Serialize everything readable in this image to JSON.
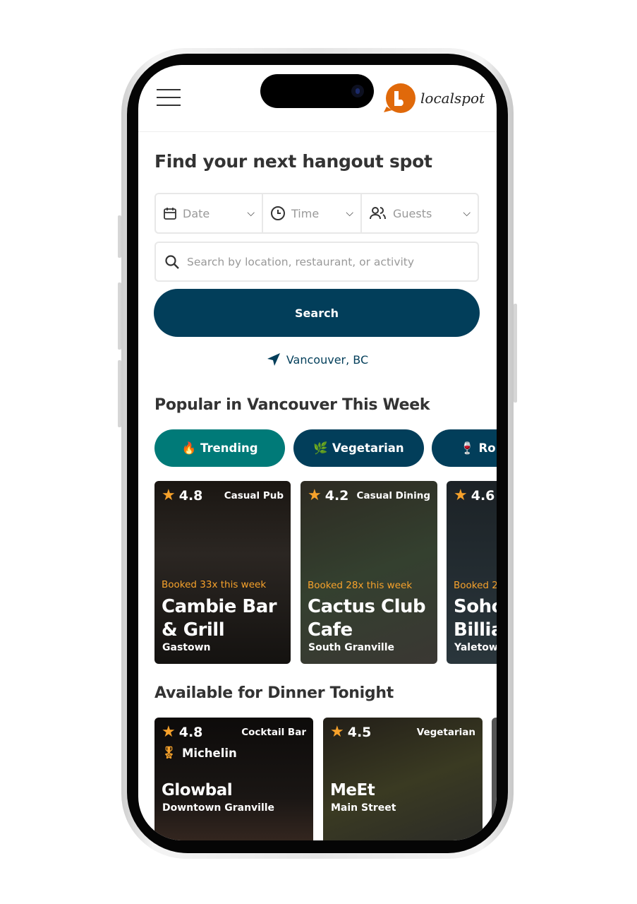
{
  "header": {
    "brand": "localspot",
    "menu_icon": "hamburger-icon"
  },
  "hero": {
    "title": "Find your next hangout spot"
  },
  "filters": [
    {
      "label": "Date",
      "icon": "calendar-icon"
    },
    {
      "label": "Time",
      "icon": "clock-icon"
    },
    {
      "label": "Guests",
      "icon": "users-icon"
    }
  ],
  "search": {
    "placeholder": "Search by location, restaurant, or activity",
    "button": "Search"
  },
  "location": "Vancouver, BC",
  "popular": {
    "title": "Popular in Vancouver This Week",
    "chips": [
      {
        "emoji": "🔥",
        "label": "Trending",
        "color": "#007a78"
      },
      {
        "emoji": "🌿",
        "label": "Vegetarian",
        "color": "#023e5a"
      },
      {
        "emoji": "🍷",
        "label": "Romantic",
        "color": "#023e5a"
      }
    ],
    "cards": [
      {
        "rating": "4.8",
        "category": "Casual Pub",
        "booked": "Booked 33x this week",
        "name": "Cambie Bar & Grill",
        "area": "Gastown"
      },
      {
        "rating": "4.2",
        "category": "Casual Dining",
        "booked": "Booked 28x this week",
        "name": "Cactus Club Cafe",
        "area": "South Granville"
      },
      {
        "rating": "4.6",
        "category": "",
        "booked": "Booked 2",
        "name": "Soho Billiards",
        "area": "Yaletown"
      }
    ]
  },
  "dinner": {
    "title": "Available for Dinner Tonight",
    "cards": [
      {
        "rating": "4.8",
        "category": "Cocktail Bar",
        "badge": "Michelin",
        "name": "Glowbal",
        "area": "Downtown Granville"
      },
      {
        "rating": "4.5",
        "category": "Vegetarian",
        "name": "MeEt",
        "area": "Main Street"
      }
    ]
  }
}
